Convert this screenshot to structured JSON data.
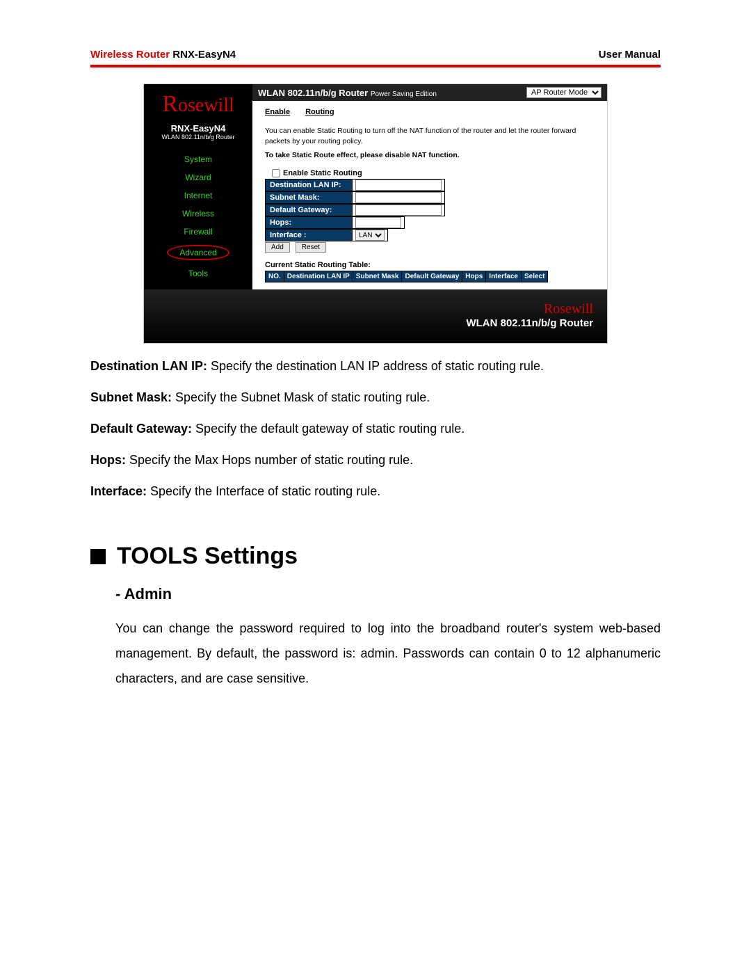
{
  "doc_header": {
    "brand": "Wireless Router",
    "model": "RNX-EasyN4",
    "right": "User Manual"
  },
  "router_ui": {
    "logo_text": "Rosewill",
    "model_name": "RNX-EasyN4",
    "model_sub": "WLAN 802.11n/b/g Router",
    "nav": [
      "System",
      "Wizard",
      "Internet",
      "Wireless",
      "Firewall",
      "Advanced",
      "Tools"
    ],
    "active_nav": "Advanced",
    "title_main": "WLAN 802.11n/b/g Router",
    "title_sub": "Power Saving Edition",
    "mode_select": "AP Router Mode",
    "tabs": [
      "Enable",
      "Routing"
    ],
    "note_line1": "You can enable Static Routing to turn off the NAT function of the router and let the router forward packets by your routing policy.",
    "note_line2": "To take Static Route effect, please disable NAT function.",
    "checkbox_label": "Enable Static Routing",
    "fields": {
      "dest_ip": "Destination LAN IP:",
      "subnet": "Subnet Mask:",
      "gateway": "Default Gateway:",
      "hops": "Hops:",
      "iface": "Interface :"
    },
    "iface_value": "LAN",
    "buttons": {
      "add": "Add",
      "reset": "Reset"
    },
    "table_title": "Current Static Routing Table:",
    "table_headers": [
      "NO.",
      "Destination LAN IP",
      "Subnet Mask",
      "Default Gateway",
      "Hops",
      "Interface",
      "Select"
    ],
    "footer": "WLAN 802.11n/b/g Router"
  },
  "defs": [
    {
      "term": "Destination LAN IP:",
      "text": " Specify the destination LAN IP address of static routing rule."
    },
    {
      "term": "Subnet Mask:",
      "text": " Specify the Subnet Mask of static routing rule."
    },
    {
      "term": "Default Gateway:",
      "text": " Specify the default gateway of static routing rule."
    },
    {
      "term": "Hops:",
      "text": " Specify the Max Hops number of static routing rule."
    },
    {
      "term": "Interface:",
      "text": " Specify the Interface of static routing rule."
    }
  ],
  "section": {
    "heading": "TOOLS Settings",
    "sub": "- Admin",
    "para": "You can change the password required to log into the broadband router's system web-based management. By default, the password is: admin. Passwords can contain 0 to 12 alphanumeric characters, and are case sensitive."
  }
}
